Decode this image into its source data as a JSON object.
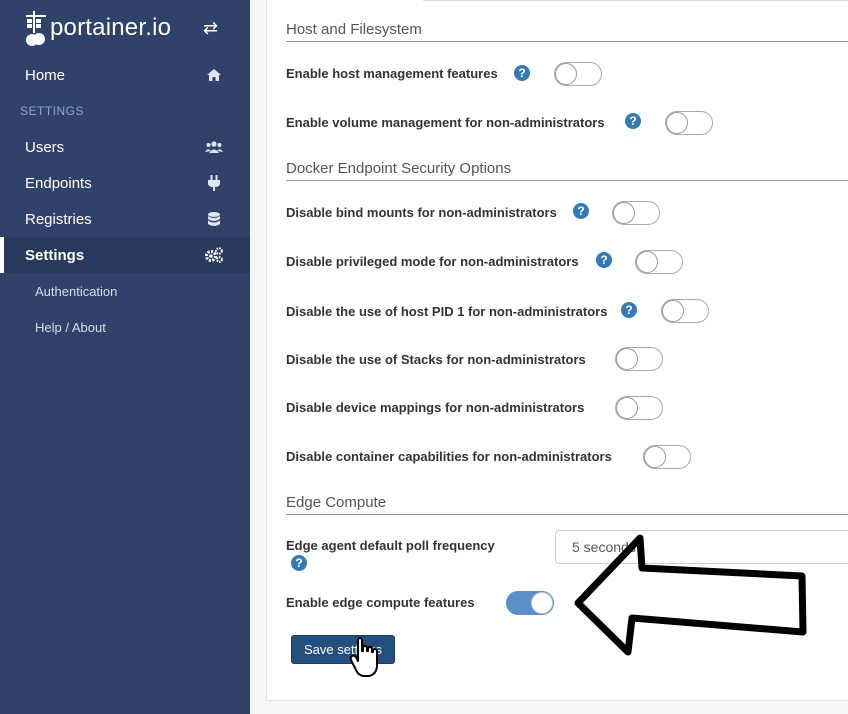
{
  "brand": {
    "name": "portainer.io"
  },
  "sidebar": {
    "home": "Home",
    "section": "SETTINGS",
    "items": [
      {
        "label": "Users",
        "icon": "users-icon"
      },
      {
        "label": "Endpoints",
        "icon": "plug-icon"
      },
      {
        "label": "Registries",
        "icon": "database-icon"
      },
      {
        "label": "Settings",
        "icon": "cogs-icon"
      }
    ],
    "sub": [
      "Authentication",
      "Help / About"
    ]
  },
  "host_fs": {
    "title": "Host and Filesystem",
    "host_mgmt": "Enable host management features",
    "volume_mgmt": "Enable volume management for non-administrators"
  },
  "docker_sec": {
    "title": "Docker Endpoint Security Options",
    "bind_mounts": "Disable bind mounts for non-administrators",
    "privileged": "Disable privileged mode for non-administrators",
    "host_pid": "Disable the use of host PID 1 for non-administrators",
    "stacks": "Disable the use of Stacks for non-administrators",
    "device_map": "Disable device mappings for non-administrators",
    "capabilities": "Disable container capabilities for non-administrators"
  },
  "edge": {
    "title": "Edge Compute",
    "poll_label": "Edge agent default poll frequency",
    "poll_value": "5 seconds",
    "enable_label": "Enable edge compute features",
    "enable_on": true
  },
  "actions": {
    "save": "Save settings"
  },
  "help_glyph": "?",
  "colors": {
    "sidebar": "#30426a",
    "accent": "#337ab7",
    "button": "#23507e",
    "switch_on": "#5b8fc8"
  }
}
